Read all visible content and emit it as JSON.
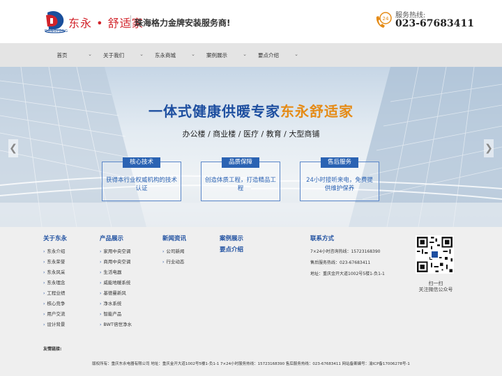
{
  "header": {
    "logo_text": "东永 • 舒适家",
    "logo_sub": "DONGYONG",
    "slogan": "珠海格力金牌安装服务商!",
    "hotline_badge": "24",
    "hotline_label": "服务热线:",
    "hotline_number": "023-67683411"
  },
  "nav": {
    "items": [
      {
        "label": "首页"
      },
      {
        "label": "关于我们"
      },
      {
        "label": "东永商城"
      },
      {
        "label": "案例展示"
      },
      {
        "label": "要点介绍"
      }
    ],
    "chevron": "⌄"
  },
  "banner": {
    "title_main": "一体式健康供暖专家",
    "title_accent": "东永舒适家",
    "subtitle": "办公楼 / 商业楼 / 医疗 / 教育 / 大型商铺",
    "prev_arrow": "❮",
    "next_arrow": "❯",
    "cards": [
      {
        "tag": "核心技术",
        "text": "获得本行业权威机构的技术认证"
      },
      {
        "tag": "品质保障",
        "text": "创造体质工程，打造精品工程"
      },
      {
        "tag": "售后服务",
        "text": "24小时接听来电，免费提供维护保养"
      }
    ]
  },
  "footer": {
    "about": {
      "title": "关于东永",
      "items": [
        "东永介绍",
        "东永荣誉",
        "东永风采",
        "东永理念",
        "工程业绩",
        "核心竞争",
        "用户交流",
        "设计背景"
      ]
    },
    "products": {
      "title": "产品展示",
      "items": [
        "家用中央空调",
        "商用中央空调",
        "生活电器",
        "威能地暖系统",
        "基德曼新风",
        "净水系统",
        "智能产品",
        "BWT倍世净水"
      ]
    },
    "news": {
      "title": "新闻资讯",
      "items": [
        "公司新闻",
        "行业动态"
      ]
    },
    "cases": {
      "title": "案例展示",
      "subtitle": "要点介绍"
    },
    "contact": {
      "title": "联系方式",
      "lines": [
        "7×24小时咨询热线：15723168390",
        "售后服务热线：023-67683411",
        "地址：重庆金开大道1002号5楼1-负1-1"
      ]
    },
    "qr_caption_1": "扫一扫",
    "qr_caption_2": "关注微信公众号",
    "links_label": "友情链接:",
    "copyright": "版权所有：重庆东永电器有限公司     地址：重庆金开大道1002号5楼1-负1-1     7×24小时服务热线：15723168390     售后服务热线：023-67683411     网站备案编号：渝ICP备17006278号-1",
    "caret": "›"
  },
  "colors": {
    "brand_blue": "#1e4fa0",
    "brand_red": "#d2232a",
    "accent_orange": "#e58b16",
    "card_blue": "#2b63b3"
  }
}
